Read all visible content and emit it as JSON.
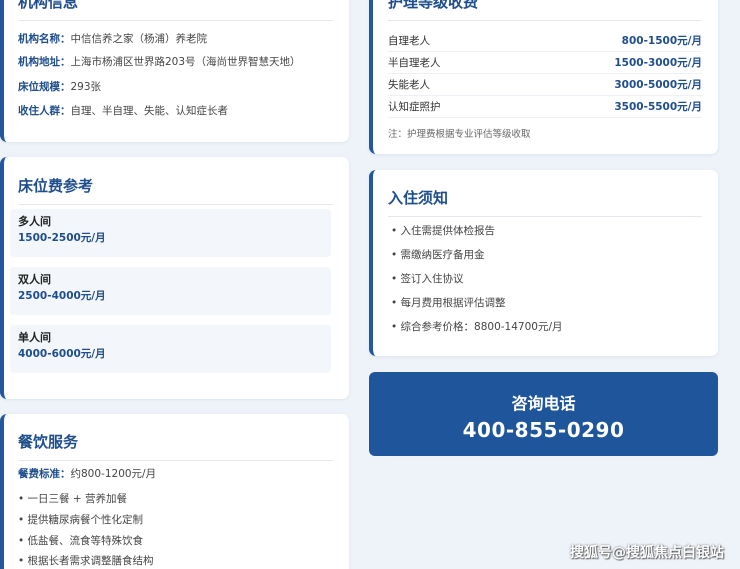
{
  "institution": {
    "title": "机构信息",
    "rows": [
      {
        "key": "机构名称",
        "value": "中信信养之家（杨浦）养老院"
      },
      {
        "key": "机构地址",
        "value": "上海市杨浦区世界路203号（海尚世界智慧天地）"
      },
      {
        "key": "床位规模",
        "value": "293张"
      },
      {
        "key": "收住人群",
        "value": "自理、半自理、失能、认知症长者"
      }
    ]
  },
  "care": {
    "title": "护理等级收费",
    "rows": [
      {
        "level": "自理老人",
        "price": "800-1500元/月"
      },
      {
        "level": "半自理老人",
        "price": "1500-3000元/月"
      },
      {
        "level": "失能老人",
        "price": "3000-5000元/月"
      },
      {
        "level": "认知症照护",
        "price": "3500-5500元/月"
      }
    ],
    "note": "注：护理费根据专业评估等级收取"
  },
  "beds": {
    "title": "床位费参考",
    "rooms": [
      {
        "name": "多人间",
        "price": "1500-2500元/月"
      },
      {
        "name": "双人间",
        "price": "2500-4000元/月"
      },
      {
        "name": "单人间",
        "price": "4000-6000元/月"
      }
    ]
  },
  "admission": {
    "title": "入住须知",
    "items": [
      "• 入住需提供体检报告",
      "• 需缴纳医疗备用金",
      "• 签订入住协议",
      "• 每月费用根据评估调整",
      "• 综合参考价格：8800-14700元/月"
    ]
  },
  "dining": {
    "title": "餐饮服务",
    "fee_key": "餐费标准：",
    "fee_value": "约800-1200元/月",
    "items": [
      "• 一日三餐 + 营养加餐",
      "• 提供糖尿病餐个性化定制",
      "• 低盐餐、流食等特殊饮食",
      "• 根据长者需求调整膳食结构"
    ]
  },
  "contact": {
    "label": "咨询电话",
    "phone": "400-855-0290"
  },
  "watermark": "搜狐号@搜狐焦点白银站",
  "colors": {
    "accent": "#1f4e8c",
    "contact_bg": "#1f559b",
    "page_bg": "#eef3f9"
  }
}
